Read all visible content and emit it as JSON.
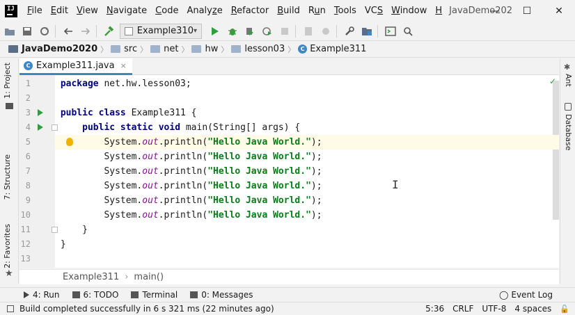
{
  "menu": {
    "items": [
      {
        "pre": "",
        "ul": "F",
        "post": "ile"
      },
      {
        "pre": "",
        "ul": "E",
        "post": "dit"
      },
      {
        "pre": "",
        "ul": "V",
        "post": "iew"
      },
      {
        "pre": "",
        "ul": "N",
        "post": "avigate"
      },
      {
        "pre": "",
        "ul": "C",
        "post": "ode"
      },
      {
        "pre": "Analy",
        "ul": "z",
        "post": "e"
      },
      {
        "pre": "",
        "ul": "R",
        "post": "efactor"
      },
      {
        "pre": "",
        "ul": "B",
        "post": "uild"
      },
      {
        "pre": "R",
        "ul": "u",
        "post": "n"
      },
      {
        "pre": "",
        "ul": "T",
        "post": "ools"
      },
      {
        "pre": "VC",
        "ul": "S",
        "post": ""
      },
      {
        "pre": "",
        "ul": "W",
        "post": "indow"
      },
      {
        "pre": "",
        "ul": "H",
        "post": ""
      }
    ],
    "window_title": "JavaDemo202",
    "minimize": "—",
    "maximize": "☐",
    "close": "✕"
  },
  "toolbar": {
    "run_config": "Example310"
  },
  "navbar": {
    "project": "JavaDemo2020",
    "crumbs": [
      "src",
      "net",
      "hw",
      "lesson03"
    ],
    "file": "Example311"
  },
  "left_strip": {
    "project_tab": "1: Project",
    "structure_tab": "7: Structure",
    "favorites_tab": "2: Favorites"
  },
  "right_strip": {
    "ant_tab": "Ant",
    "database_tab": "Database"
  },
  "editor_tab": {
    "label": "Example311.java",
    "close": "×"
  },
  "code": {
    "line_numbers": [
      "1",
      "2",
      "3",
      "4",
      "5",
      "6",
      "7",
      "8",
      "9",
      "10",
      "11",
      "12",
      "13"
    ],
    "l1_kw": "package",
    "l1_rest": " net.hw.lesson03;",
    "l3_kw": "public class",
    "l3_rest": " Example311 {",
    "l4_kw": "public static void",
    "l4_rest": " main(String[] args) {",
    "println_prefix": "System.",
    "println_field": "out",
    "println_call": ".println(",
    "println_string": "\"Hello Java World.\"",
    "println_end": ");",
    "l11": "}",
    "l12": "}"
  },
  "editor_breadcrumb": {
    "class": "Example311",
    "method": "main()"
  },
  "bottom_bar": {
    "run": "4: Run",
    "todo": "6: TODO",
    "terminal": "Terminal",
    "messages": "0: Messages",
    "event_log": "Event Log"
  },
  "status": {
    "message": "Build completed successfully in 6 s 321 ms (22 minutes ago)",
    "position": "5:36",
    "line_sep": "CRLF",
    "encoding": "UTF-8",
    "indent": "4 spaces"
  }
}
